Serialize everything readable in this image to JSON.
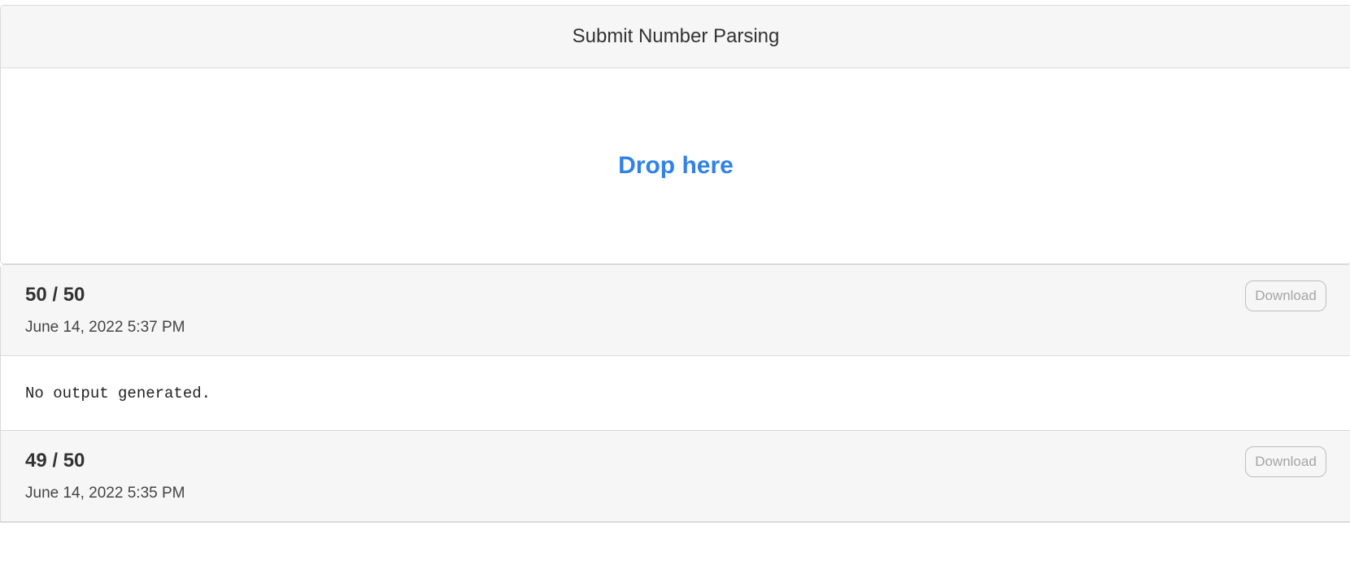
{
  "submit_card": {
    "title": "Submit Number Parsing",
    "dropzone_label": "Drop here"
  },
  "results": [
    {
      "score": "50 / 50",
      "timestamp": "June 14, 2022 5:37 PM",
      "download_label": "Download",
      "output": "No output generated."
    },
    {
      "score": "49 / 50",
      "timestamp": "June 14, 2022 5:35 PM",
      "download_label": "Download",
      "output": ""
    }
  ],
  "colors": {
    "accent": "#3182e6",
    "header_bg": "#f6f6f6",
    "border": "#d9d9d9"
  }
}
